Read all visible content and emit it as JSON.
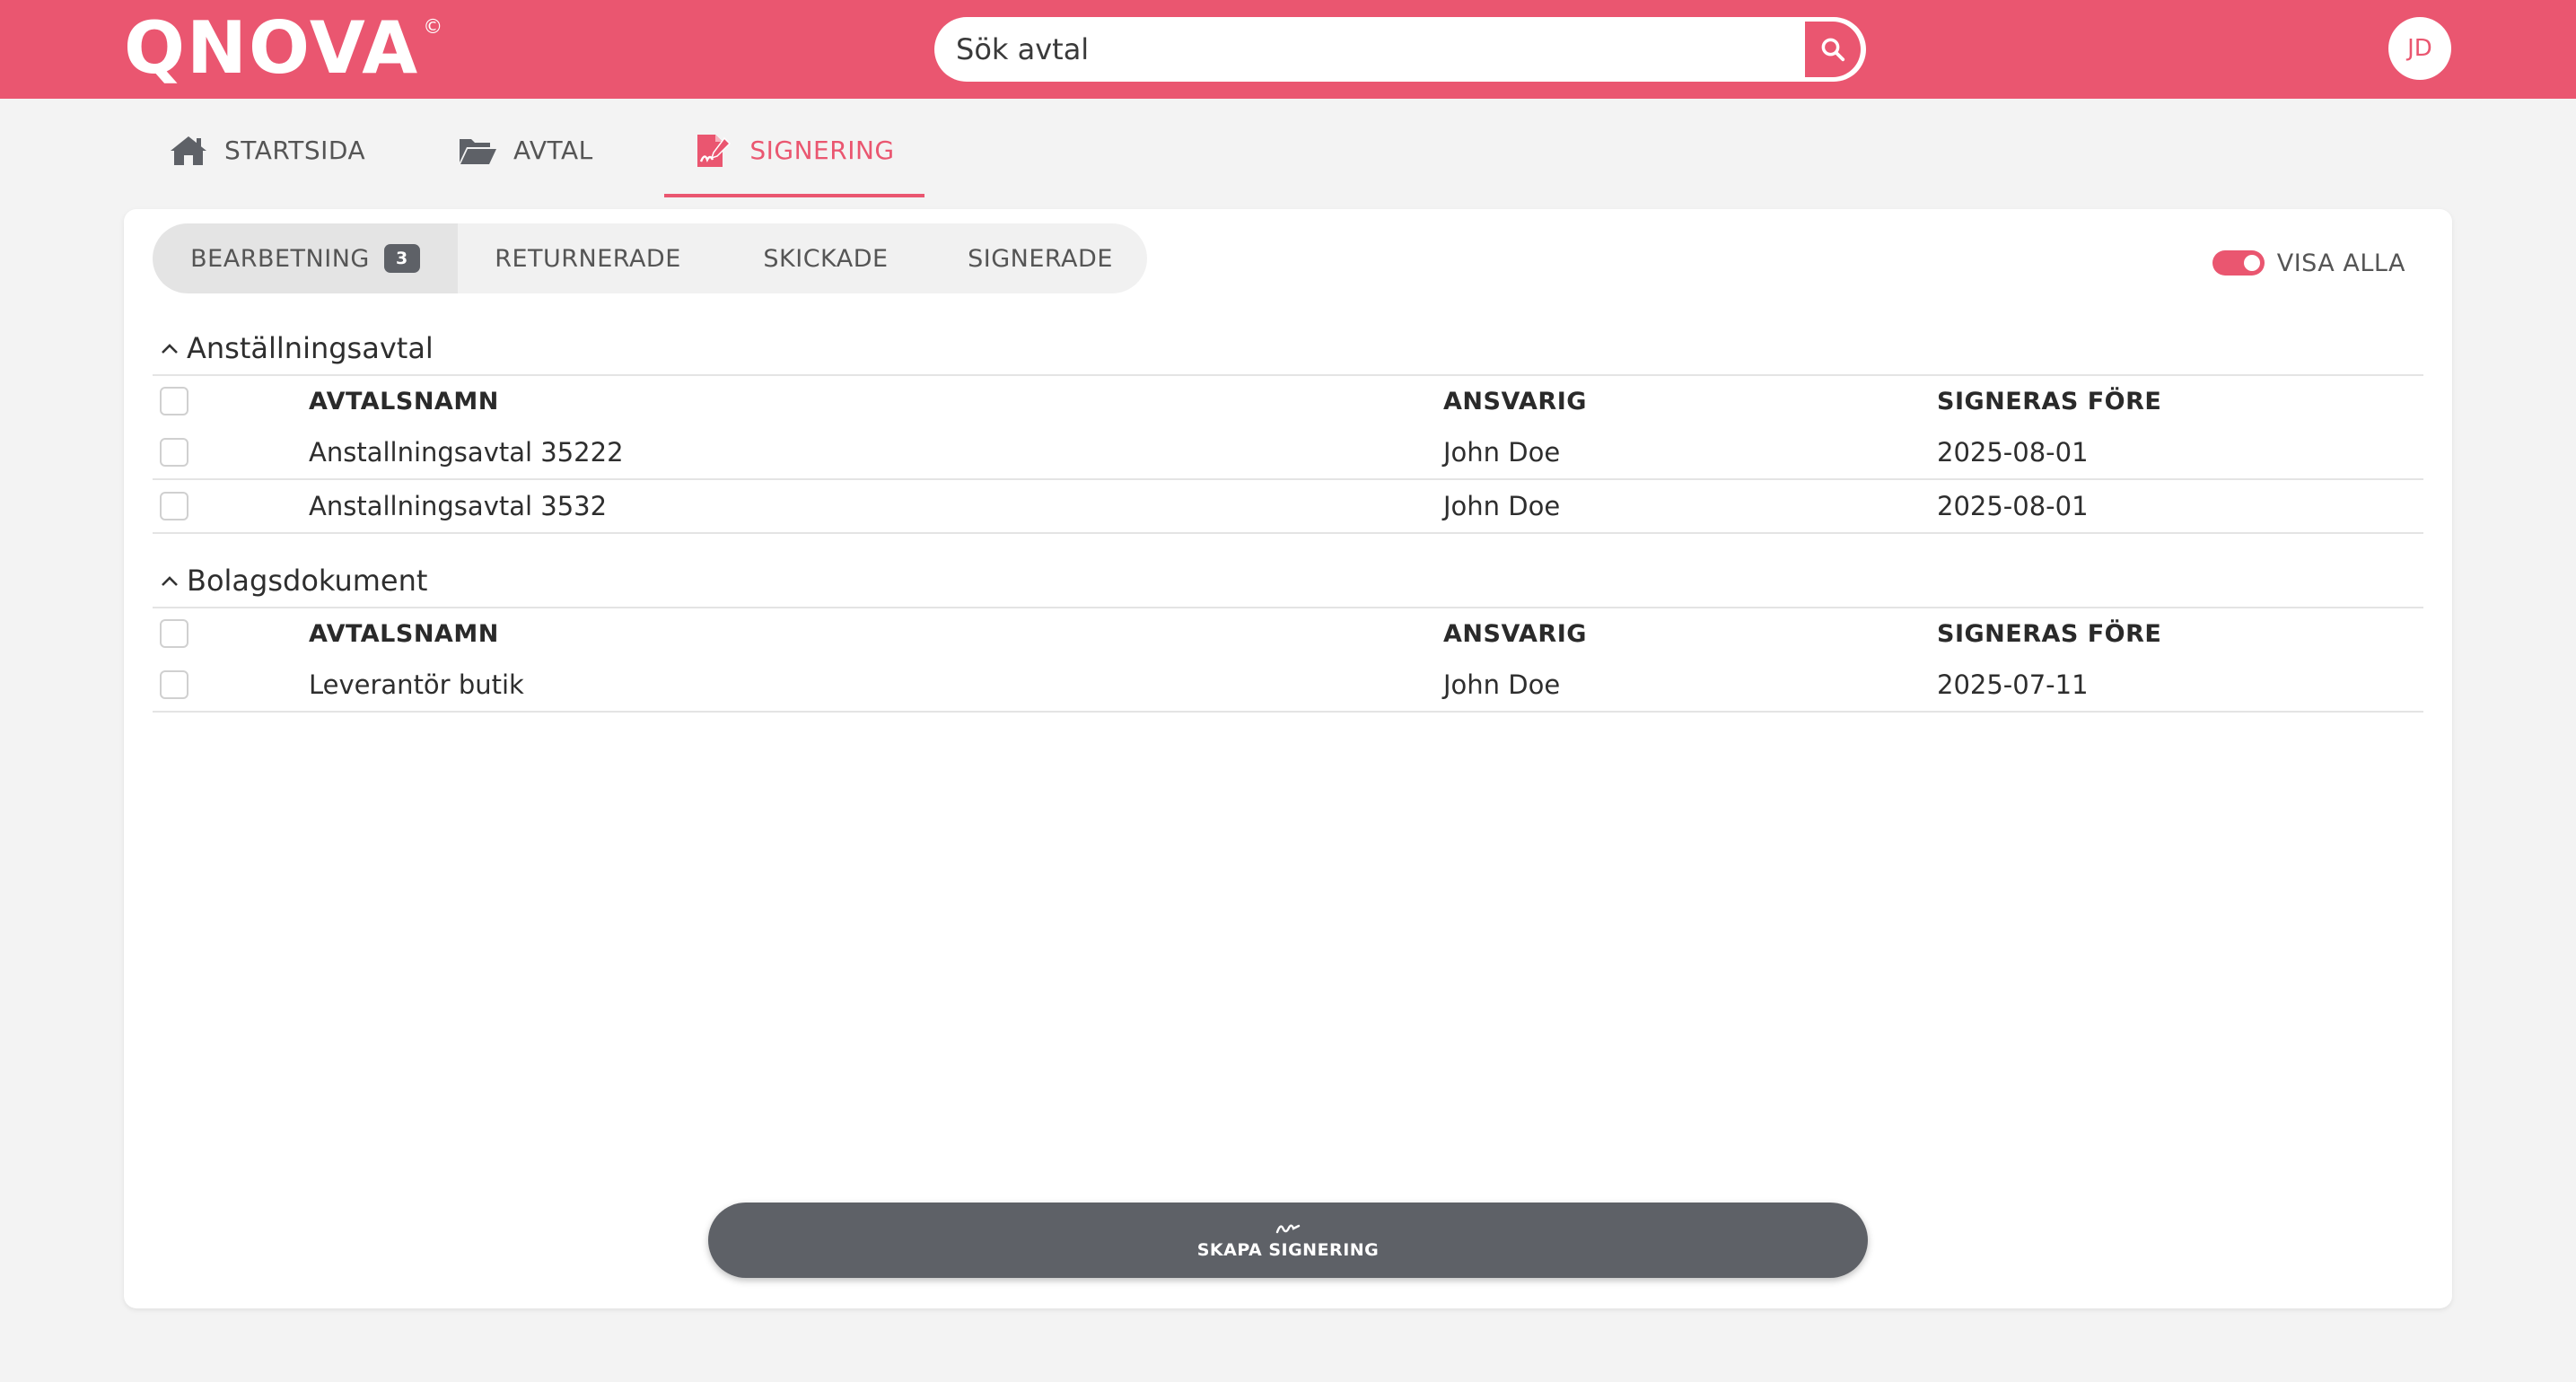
{
  "header": {
    "logo_text": "QNOVA",
    "logo_mark": "©",
    "search_placeholder": "Sök avtal",
    "avatar_initials": "JD"
  },
  "nav": {
    "tabs": [
      {
        "label": "STARTSIDA",
        "icon": "home-icon"
      },
      {
        "label": "AVTAL",
        "icon": "folder-open-icon"
      },
      {
        "label": "SIGNERING",
        "icon": "signature-icon",
        "active": true
      }
    ]
  },
  "subtabs": [
    {
      "label": "BEARBETNING",
      "badge": "3",
      "active": true
    },
    {
      "label": "RETURNERADE"
    },
    {
      "label": "SKICKADE"
    },
    {
      "label": "SIGNERADE"
    }
  ],
  "toggle": {
    "label": "VISA ALLA",
    "on": true
  },
  "columns": {
    "name": "AVTALSNAMN",
    "responsible": "ANSVARIG",
    "deadline": "SIGNERAS FÖRE"
  },
  "groups": [
    {
      "title": "Anställningsavtal",
      "rows": [
        {
          "name": "Anstallningsavtal 35222",
          "responsible": "John Doe",
          "deadline": "2025-08-01"
        },
        {
          "name": "Anstallningsavtal 3532",
          "responsible": "John Doe",
          "deadline": "2025-08-01"
        }
      ]
    },
    {
      "title": "Bolagsdokument",
      "rows": [
        {
          "name": "Leverantör butik",
          "responsible": "John Doe",
          "deadline": "2025-07-11"
        }
      ]
    }
  ],
  "create_button": {
    "label": "SKAPA SIGNERING",
    "icon": "signature-scribble-icon"
  },
  "colors": {
    "brand": "#ea5670",
    "dark_button": "#5e6167",
    "background": "#f3f3f3"
  }
}
